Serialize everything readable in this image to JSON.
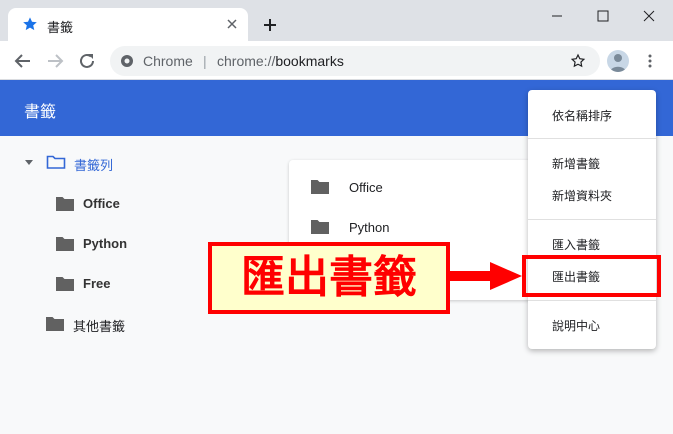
{
  "window": {
    "tab_title": "書籤",
    "icons": {
      "tab": "star-icon",
      "close": "close-icon",
      "new_tab": "plus-icon",
      "minimize": "minimize-icon",
      "maximize": "maximize-icon",
      "window_close": "close-icon"
    }
  },
  "toolbar": {
    "site_chip": "Chrome",
    "url_scheme": "chrome://",
    "url_path": "bookmarks",
    "separator": "|",
    "icons": {
      "back": "back-arrow-icon",
      "forward": "forward-arrow-icon",
      "reload": "reload-icon",
      "bookmark": "star-outline-icon",
      "menu": "kebab-menu-icon"
    }
  },
  "app": {
    "title": "書籤",
    "accent_color": "#3367d6"
  },
  "sidebar": {
    "items": [
      {
        "label": "書籤列",
        "selected": true,
        "expanded": true,
        "icon": "folder-outline-icon"
      },
      {
        "label": "Office",
        "icon": "folder-icon"
      },
      {
        "label": "Python",
        "icon": "folder-icon"
      },
      {
        "label": "Free",
        "icon": "folder-icon"
      },
      {
        "label": "其他書籤",
        "icon": "folder-icon"
      }
    ]
  },
  "main": {
    "rows": [
      {
        "label": "Office",
        "icon": "folder-icon"
      },
      {
        "label": "Python",
        "icon": "folder-icon"
      }
    ]
  },
  "menu": {
    "items": [
      {
        "label": "依名稱排序"
      },
      {
        "label": "新增書籤"
      },
      {
        "label": "新增資料夾"
      },
      {
        "label": "匯入書籤"
      },
      {
        "label": "匯出書籤",
        "highlighted": true
      },
      {
        "label": "說明中心"
      }
    ]
  },
  "annotation": {
    "callout_text": "匯出書籤",
    "color": "#ff0000",
    "fill": "#ffffcc"
  }
}
